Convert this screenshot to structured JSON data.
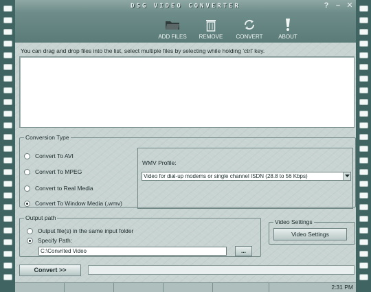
{
  "window": {
    "title": "DSG VIDEO CONVERTER",
    "help_glyph": "?",
    "minimize_glyph": "–",
    "close_glyph": "✕"
  },
  "toolbar": {
    "buttons": [
      {
        "label": "ADD FILES",
        "icon": "folder-icon"
      },
      {
        "label": "REMOVE",
        "icon": "trash-icon"
      },
      {
        "label": "CONVERT",
        "icon": "convert-arrows-icon"
      },
      {
        "label": "ABOUT",
        "icon": "exclamation-icon"
      }
    ]
  },
  "hint": "You can drag and drop files into the list, select multiple files by selecting while holding 'ctrl' key.",
  "conversion": {
    "legend": "Conversion Type",
    "options": [
      {
        "label": "Convert To AVI",
        "selected": false
      },
      {
        "label": "Convert To MPEG",
        "selected": false
      },
      {
        "label": "Convert to Real Media",
        "selected": false
      },
      {
        "label": "Convert To Window Media (.wmv)",
        "selected": true
      }
    ],
    "wmv_profile_label": "WMV Profile:",
    "wmv_profile_value": "Video for dial-up modems or single channel ISDN (28.8 to 56 Kbps)"
  },
  "output": {
    "legend": "Output path",
    "option_same_folder": "Output file(s) in the same input folder",
    "option_specify": "Specify Path:",
    "path_value": "C:\\Convrited Video",
    "browse_label": "..."
  },
  "video_settings": {
    "legend": "Video Settings",
    "button_label": "Video Settings"
  },
  "convert_button": "Convert >>",
  "status": {
    "time": "2:31 PM"
  },
  "colors": {
    "film": "#3f6461",
    "toolbar": "#5a7b78",
    "body": "#c8d4d2"
  }
}
